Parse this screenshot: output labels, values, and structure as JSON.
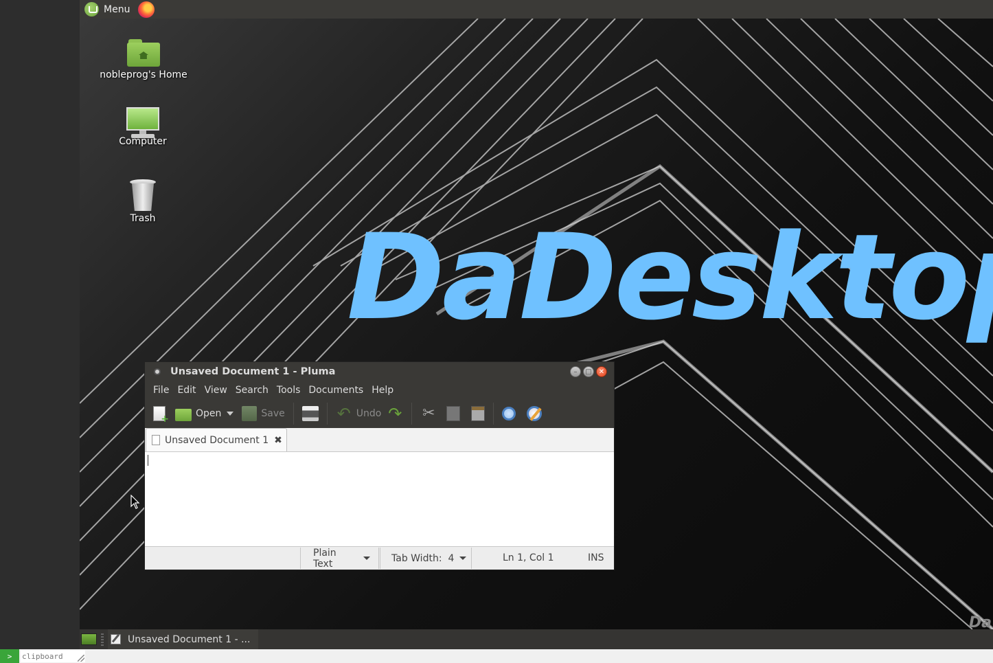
{
  "top_panel": {
    "menu_label": "Menu",
    "menu_icon": "linux-mint-icon",
    "launchers": [
      {
        "icon": "firefox-icon"
      }
    ]
  },
  "desktop": {
    "icons": [
      {
        "label": "nobleprog's Home",
        "icon": "home-folder-icon"
      },
      {
        "label": "Computer",
        "icon": "computer-icon"
      },
      {
        "label": "Trash",
        "icon": "trash-icon"
      }
    ],
    "wallpaper_text": "DaDesktop",
    "wallpaper_text_color": "#6fc1ff",
    "corner_watermark": "Da"
  },
  "window": {
    "title": "Unsaved Document 1 - Pluma",
    "menu": [
      "File",
      "Edit",
      "View",
      "Search",
      "Tools",
      "Documents",
      "Help"
    ],
    "toolbar": {
      "open_label": "Open",
      "save_label": "Save",
      "undo_label": "Undo"
    },
    "tab": {
      "label": "Unsaved Document 1"
    },
    "editor_content": "",
    "statusbar": {
      "language": "Plain Text",
      "tab_width": "Tab Width:  4",
      "position": "Ln 1, Col 1",
      "mode": "INS"
    }
  },
  "taskbar": {
    "tasks": [
      {
        "label": "Unsaved Document 1 - ..."
      }
    ]
  },
  "clipboard_bar": {
    "prompt": ">",
    "placeholder": "clipboard"
  }
}
